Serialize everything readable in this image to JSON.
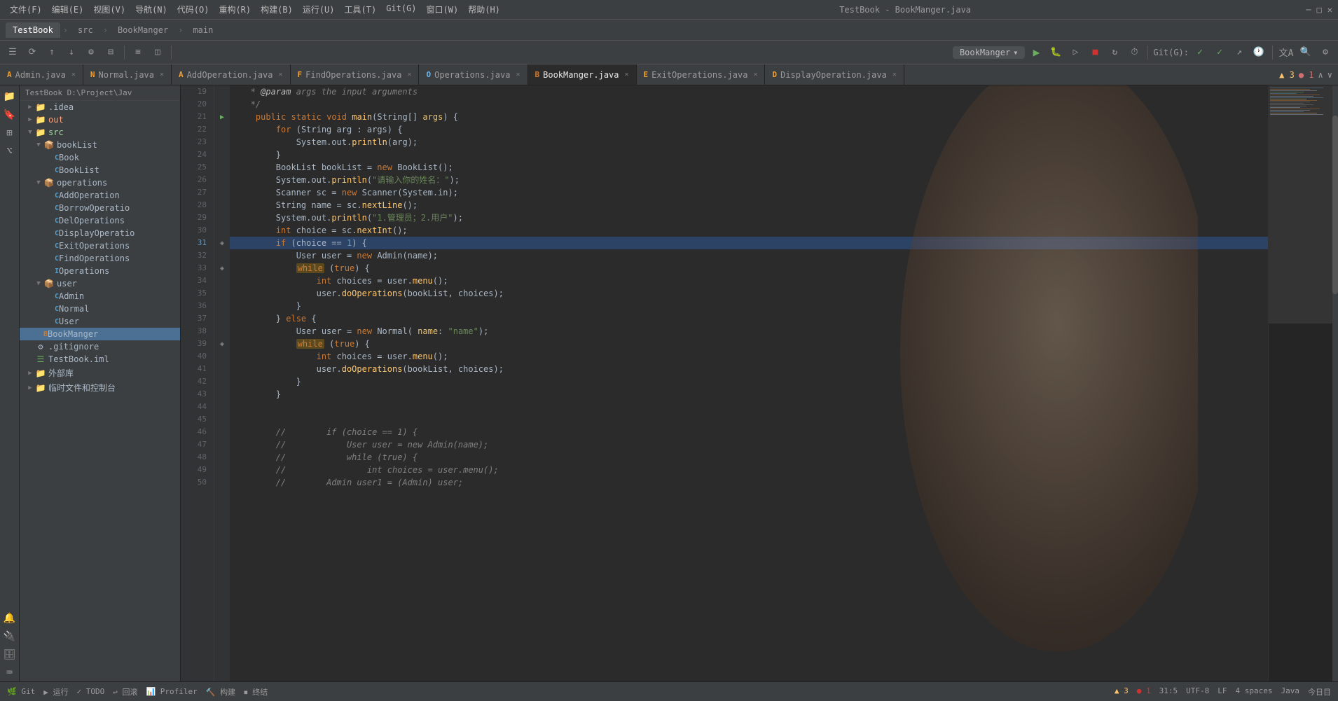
{
  "titlebar": {
    "menu_items": [
      "文件(F)",
      "编辑(E)",
      "视图(V)",
      "导航(N)",
      "代码(O)",
      "重构(R)",
      "构建(B)",
      "运行(U)",
      "工具(T)",
      "Git(G)",
      "窗口(W)",
      "帮助(H)"
    ],
    "title": "TestBook - BookManger.java"
  },
  "nav": {
    "tabs": [
      "TestBook",
      "src",
      "BookManger",
      "main"
    ]
  },
  "toolbar": {
    "project_label": "BookManger",
    "git_label": "Git(G):",
    "run_btn": "▶",
    "search_icon": "🔍"
  },
  "file_tabs": [
    {
      "name": "Admin.java",
      "type": "java",
      "active": false,
      "modified": false
    },
    {
      "name": "Normal.java",
      "type": "java",
      "active": false,
      "modified": false
    },
    {
      "name": "AddOperation.java",
      "type": "java",
      "active": false,
      "modified": false
    },
    {
      "name": "FindOperations.java",
      "type": "java",
      "active": false,
      "modified": false
    },
    {
      "name": "Operations.java",
      "type": "java",
      "active": false,
      "modified": false
    },
    {
      "name": "BookManger.java",
      "type": "java-main",
      "active": true,
      "modified": false
    },
    {
      "name": "ExitOperations.java",
      "type": "java",
      "active": false,
      "modified": false
    },
    {
      "name": "DisplayOperation.java",
      "type": "java",
      "active": false,
      "modified": false
    }
  ],
  "sidebar": {
    "project_label": "TestBook D:\\Project\\Jav",
    "tree": [
      {
        "id": "idea",
        "label": ".idea",
        "type": "folder",
        "indent": 1,
        "expanded": false
      },
      {
        "id": "out",
        "label": "out",
        "type": "folder",
        "indent": 1,
        "expanded": false
      },
      {
        "id": "src",
        "label": "src",
        "type": "folder",
        "indent": 1,
        "expanded": true
      },
      {
        "id": "bookList",
        "label": "bookList",
        "type": "package",
        "indent": 2,
        "expanded": true
      },
      {
        "id": "Book",
        "label": "Book",
        "type": "class",
        "indent": 3
      },
      {
        "id": "BookList",
        "label": "BookList",
        "type": "class",
        "indent": 3
      },
      {
        "id": "operations",
        "label": "operations",
        "type": "package",
        "indent": 2,
        "expanded": true
      },
      {
        "id": "AddOperation",
        "label": "AddOperation",
        "type": "class",
        "indent": 3
      },
      {
        "id": "BorrowOperatio",
        "label": "BorrowOperatio",
        "type": "class",
        "indent": 3
      },
      {
        "id": "DelOperations",
        "label": "DelOperations",
        "type": "class",
        "indent": 3
      },
      {
        "id": "DisplayOperatio",
        "label": "DisplayOperatio",
        "type": "class",
        "indent": 3
      },
      {
        "id": "ExitOperations",
        "label": "ExitOperations",
        "type": "class",
        "indent": 3
      },
      {
        "id": "FindOperations",
        "label": "FindOperations",
        "type": "class",
        "indent": 3
      },
      {
        "id": "Operations",
        "label": "Operations",
        "type": "interface",
        "indent": 3
      },
      {
        "id": "user",
        "label": "user",
        "type": "package",
        "indent": 2,
        "expanded": true
      },
      {
        "id": "Admin",
        "label": "Admin",
        "type": "class",
        "indent": 3
      },
      {
        "id": "Normal",
        "label": "Normal",
        "type": "class",
        "indent": 3
      },
      {
        "id": "User",
        "label": "User",
        "type": "class",
        "indent": 3
      },
      {
        "id": "BookManger",
        "label": "BookManger",
        "type": "main-class",
        "indent": 2,
        "selected": true
      },
      {
        "id": "gitignore",
        "label": ".gitignore",
        "type": "file",
        "indent": 1
      },
      {
        "id": "TestBook.iml",
        "label": "TestBook.iml",
        "type": "iml",
        "indent": 1
      },
      {
        "id": "ext-libs",
        "label": "外部库",
        "type": "folder",
        "indent": 1,
        "expanded": false
      },
      {
        "id": "temp-files",
        "label": "临时文件和控制台",
        "type": "folder",
        "indent": 1,
        "expanded": false
      }
    ]
  },
  "code": {
    "lines": [
      {
        "num": 19,
        "content": "   * @param args the input arguments",
        "type": "comment"
      },
      {
        "num": 20,
        "content": "   */",
        "type": "comment"
      },
      {
        "num": 21,
        "content": "    public static void main(String[] args) {",
        "type": "code",
        "has_run": true
      },
      {
        "num": 22,
        "content": "        for (String arg : args) {",
        "type": "code"
      },
      {
        "num": 23,
        "content": "            System.out.println(arg);",
        "type": "code"
      },
      {
        "num": 24,
        "content": "        }",
        "type": "code"
      },
      {
        "num": 25,
        "content": "        BookList bookList = new BookList();",
        "type": "code"
      },
      {
        "num": 26,
        "content": "        System.out.println(\"请输入你的姓名：\");",
        "type": "code"
      },
      {
        "num": 27,
        "content": "        Scanner sc = new Scanner(System.in);",
        "type": "code"
      },
      {
        "num": 28,
        "content": "        String name = sc.nextLine();",
        "type": "code"
      },
      {
        "num": 29,
        "content": "        System.out.println(\"1.管理员；2.用户\");",
        "type": "code"
      },
      {
        "num": 30,
        "content": "        int choice = sc.nextInt();",
        "type": "code"
      },
      {
        "num": 31,
        "content": "        if (choice == 1) {",
        "type": "code",
        "has_bookmark": true
      },
      {
        "num": 32,
        "content": "            User user = new Admin(name);",
        "type": "code"
      },
      {
        "num": 33,
        "content": "            while (true) {",
        "type": "code",
        "has_bookmark": true
      },
      {
        "num": 34,
        "content": "                int choices = user.menu();",
        "type": "code"
      },
      {
        "num": 35,
        "content": "                user.doOperations(bookList, choices);",
        "type": "code"
      },
      {
        "num": 36,
        "content": "            }",
        "type": "code"
      },
      {
        "num": 37,
        "content": "        } else {",
        "type": "code"
      },
      {
        "num": 38,
        "content": "            User user = new Normal( name: \"name\");",
        "type": "code"
      },
      {
        "num": 39,
        "content": "            while (true) {",
        "type": "code",
        "has_bookmark": true
      },
      {
        "num": 40,
        "content": "                int choices = user.menu();",
        "type": "code"
      },
      {
        "num": 41,
        "content": "                user.doOperations(bookList, choices);",
        "type": "code"
      },
      {
        "num": 42,
        "content": "            }",
        "type": "code"
      },
      {
        "num": 43,
        "content": "        }",
        "type": "code"
      },
      {
        "num": 44,
        "content": "",
        "type": "empty"
      },
      {
        "num": 45,
        "content": "",
        "type": "empty"
      },
      {
        "num": 46,
        "content": "//        if (choice == 1) {",
        "type": "comment"
      },
      {
        "num": 47,
        "content": "//            User user = new Admin(name);",
        "type": "comment"
      },
      {
        "num": 48,
        "content": "//            while (true) {",
        "type": "comment"
      },
      {
        "num": 49,
        "content": "//                int choices = user.menu();",
        "type": "comment"
      },
      {
        "num": 50,
        "content": "//        Admin user1 = (Admin) user;",
        "type": "comment"
      }
    ]
  },
  "status_bar": {
    "git_label": "Git",
    "run_label": "运行",
    "todo_label": "TODO",
    "return_label": "回滚",
    "profiler_label": "Profiler",
    "build_label": "构建",
    "end_label": "终结",
    "warnings": "3",
    "errors": "1",
    "line_col": "31:5",
    "encoding": "UTF-8",
    "line_sep": "LF",
    "indent": "4 spaces",
    "lang": "Java",
    "date_label": "今日目"
  }
}
